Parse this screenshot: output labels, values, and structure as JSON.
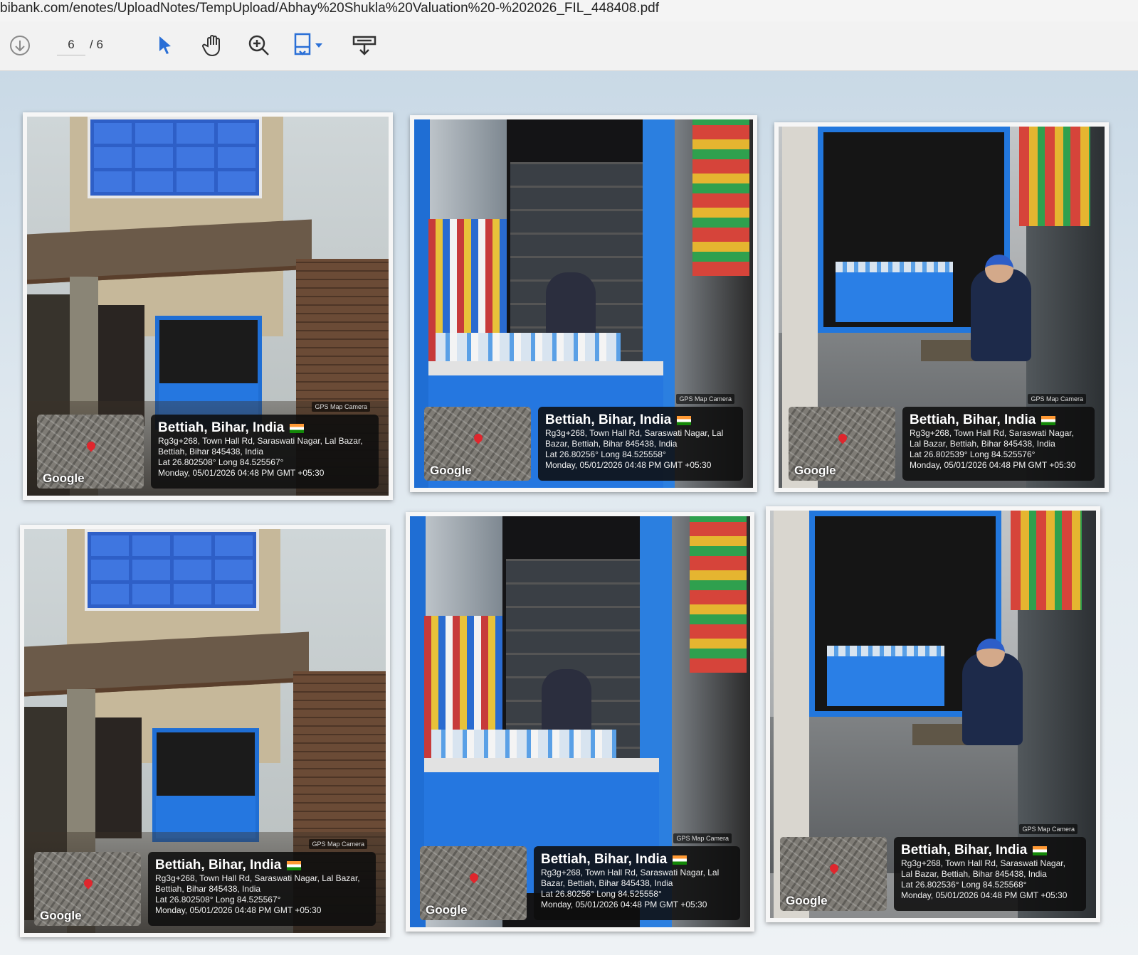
{
  "browser": {
    "url": "bibank.com/enotes/UploadNotes/TempUpload/Abhay%20Shukla%20Valuation%20-%202026_FIL_448408.pdf"
  },
  "toolbar": {
    "current_page": "6",
    "page_separator": "/ 6",
    "icons": [
      "download-circle-icon",
      "select-arrow-icon",
      "hand-pan-icon",
      "zoom-in-icon",
      "fit-page-icon",
      "dropdown-caret-icon",
      "form-download-icon"
    ],
    "accent_color": "#2a6fd6"
  },
  "photos": [
    {
      "scene": "building",
      "camera_tag": "GPS Map Camera",
      "google": "Google",
      "city": "Bettiah, Bihar, India",
      "address": "Rg3g+268, Town Hall Rd, Saraswati Nagar, Lal Bazar, Bettiah, Bihar 845438, India",
      "coords": "Lat 26.802508° Long 84.525567°",
      "datetime": "Monday, 05/01/2026 04:48 PM GMT +05:30"
    },
    {
      "scene": "interior",
      "camera_tag": "GPS Map Camera",
      "google": "Google",
      "city": "Bettiah, Bihar, India",
      "address": "Rg3g+268, Town Hall Rd, Saraswati Nagar, Lal Bazar, Bettiah, Bihar 845438, India",
      "coords": "Lat 26.80256° Long 84.525558°",
      "datetime": "Monday, 05/01/2026 04:48 PM GMT +05:30"
    },
    {
      "scene": "seated",
      "camera_tag": "GPS Map Camera",
      "google": "Google",
      "city": "Bettiah, Bihar, India",
      "address": "Rg3g+268, Town Hall Rd, Saraswati Nagar, Lal Bazar, Bettiah, Bihar 845438, India",
      "coords": "Lat 26.802539° Long 84.525576°",
      "datetime": "Monday, 05/01/2026 04:48 PM GMT +05:30"
    },
    {
      "scene": "building",
      "camera_tag": "GPS Map Camera",
      "google": "Google",
      "city": "Bettiah, Bihar, India",
      "address": "Rg3g+268, Town Hall Rd, Saraswati Nagar, Lal Bazar, Bettiah, Bihar 845438, India",
      "coords": "Lat 26.802508° Long 84.525567°",
      "datetime": "Monday, 05/01/2026 04:48 PM GMT +05:30"
    },
    {
      "scene": "interior",
      "camera_tag": "GPS Map Camera",
      "google": "Google",
      "city": "Bettiah, Bihar, India",
      "address": "Rg3g+268, Town Hall Rd, Saraswati Nagar, Lal Bazar, Bettiah, Bihar 845438, India",
      "coords": "Lat 26.80256° Long 84.525558°",
      "datetime": "Monday, 05/01/2026 04:48 PM GMT +05:30"
    },
    {
      "scene": "seated",
      "camera_tag": "GPS Map Camera",
      "google": "Google",
      "city": "Bettiah, Bihar, India",
      "address": "Rg3g+268, Town Hall Rd, Saraswati Nagar, Lal Bazar, Bettiah, Bihar 845438, India",
      "coords": "Lat 26.802536° Long 84.525568°",
      "datetime": "Monday, 05/01/2026 04:48 PM GMT +05:30"
    }
  ]
}
